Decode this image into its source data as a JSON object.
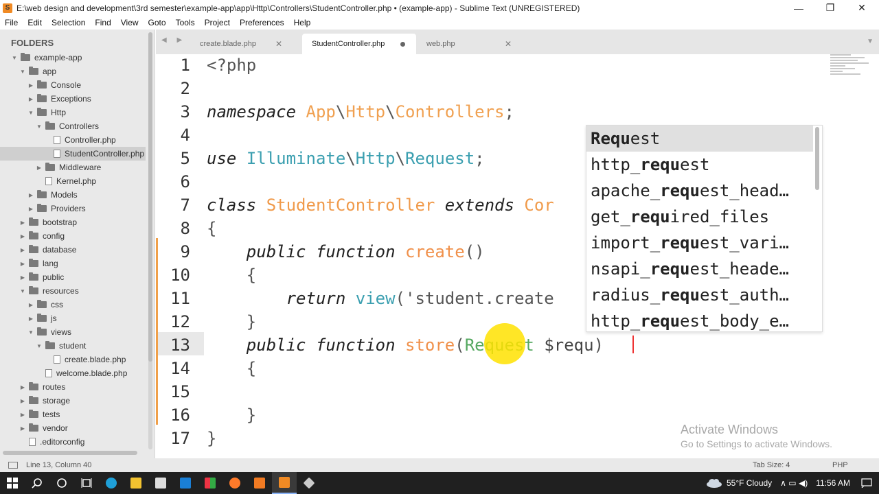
{
  "window": {
    "title": "E:\\web design and development\\3rd semester\\example-app\\app\\Http\\Controllers\\StudentController.php • (example-app) - Sublime Text (UNREGISTERED)",
    "minimize": "—",
    "maximize": "❐",
    "close": "✕"
  },
  "menu": [
    "File",
    "Edit",
    "Selection",
    "Find",
    "View",
    "Goto",
    "Tools",
    "Project",
    "Preferences",
    "Help"
  ],
  "sidebar": {
    "header": "FOLDERS",
    "items": [
      {
        "label": "example-app",
        "type": "folder",
        "depth": 0,
        "open": true
      },
      {
        "label": "app",
        "type": "folder",
        "depth": 1,
        "open": true
      },
      {
        "label": "Console",
        "type": "folder",
        "depth": 2,
        "open": false
      },
      {
        "label": "Exceptions",
        "type": "folder",
        "depth": 2,
        "open": false
      },
      {
        "label": "Http",
        "type": "folder",
        "depth": 2,
        "open": true
      },
      {
        "label": "Controllers",
        "type": "folder",
        "depth": 3,
        "open": true
      },
      {
        "label": "Controller.php",
        "type": "file",
        "depth": 4
      },
      {
        "label": "StudentController.php",
        "type": "file",
        "depth": 4,
        "selected": true
      },
      {
        "label": "Middleware",
        "type": "folder",
        "depth": 3,
        "open": false
      },
      {
        "label": "Kernel.php",
        "type": "file",
        "depth": 3
      },
      {
        "label": "Models",
        "type": "folder",
        "depth": 2,
        "open": false
      },
      {
        "label": "Providers",
        "type": "folder",
        "depth": 2,
        "open": false
      },
      {
        "label": "bootstrap",
        "type": "folder",
        "depth": 1,
        "open": false
      },
      {
        "label": "config",
        "type": "folder",
        "depth": 1,
        "open": false
      },
      {
        "label": "database",
        "type": "folder",
        "depth": 1,
        "open": false
      },
      {
        "label": "lang",
        "type": "folder",
        "depth": 1,
        "open": false
      },
      {
        "label": "public",
        "type": "folder",
        "depth": 1,
        "open": false
      },
      {
        "label": "resources",
        "type": "folder",
        "depth": 1,
        "open": true
      },
      {
        "label": "css",
        "type": "folder",
        "depth": 2,
        "open": false
      },
      {
        "label": "js",
        "type": "folder",
        "depth": 2,
        "open": false
      },
      {
        "label": "views",
        "type": "folder",
        "depth": 2,
        "open": true
      },
      {
        "label": "student",
        "type": "folder",
        "depth": 3,
        "open": true
      },
      {
        "label": "create.blade.php",
        "type": "file",
        "depth": 4
      },
      {
        "label": "welcome.blade.php",
        "type": "file",
        "depth": 3
      },
      {
        "label": "routes",
        "type": "folder",
        "depth": 1,
        "open": false
      },
      {
        "label": "storage",
        "type": "folder",
        "depth": 1,
        "open": false
      },
      {
        "label": "tests",
        "type": "folder",
        "depth": 1,
        "open": false
      },
      {
        "label": "vendor",
        "type": "folder",
        "depth": 1,
        "open": false
      },
      {
        "label": ".editorconfig",
        "type": "file",
        "depth": 1
      }
    ]
  },
  "tabs": {
    "nav": "◀ ▶",
    "menu": "▼",
    "items": [
      {
        "label": "create.blade.php",
        "close": "✕",
        "active": false
      },
      {
        "label": "StudentController.php",
        "close": "●",
        "active": true
      },
      {
        "label": "web.php",
        "close": "✕",
        "active": false
      }
    ]
  },
  "editor": {
    "line_numbers": [
      "1",
      "2",
      "3",
      "4",
      "5",
      "6",
      "7",
      "8",
      "9",
      "10",
      "11",
      "12",
      "13",
      "14",
      "15",
      "16",
      "17"
    ],
    "lines": [
      [
        [
          "<?php",
          "pn"
        ]
      ],
      [],
      [
        [
          "namespace",
          "kw"
        ],
        [
          " ",
          ""
        ],
        [
          "App",
          "ns"
        ],
        [
          "\\",
          "pn"
        ],
        [
          "Http",
          "ns"
        ],
        [
          "\\",
          "pn"
        ],
        [
          "Controllers",
          "ns"
        ],
        [
          ";",
          "pn"
        ]
      ],
      [],
      [
        [
          "use",
          "kw"
        ],
        [
          " ",
          ""
        ],
        [
          "Illuminate",
          "ty"
        ],
        [
          "\\",
          "pn"
        ],
        [
          "Http",
          "ty"
        ],
        [
          "\\",
          "pn"
        ],
        [
          "Request",
          "ty"
        ],
        [
          ";",
          "pn"
        ]
      ],
      [],
      [
        [
          "class",
          "kw"
        ],
        [
          " ",
          ""
        ],
        [
          "StudentController",
          "cls"
        ],
        [
          " ",
          ""
        ],
        [
          "extends",
          "kw"
        ],
        [
          " ",
          ""
        ],
        [
          "Cor",
          "cls"
        ]
      ],
      [
        [
          "{",
          "pn"
        ]
      ],
      [
        [
          "    ",
          ""
        ],
        [
          "public",
          "kw"
        ],
        [
          " ",
          ""
        ],
        [
          "function",
          "kw"
        ],
        [
          " ",
          ""
        ],
        [
          "create",
          "fn"
        ],
        [
          "()",
          "pn"
        ]
      ],
      [
        [
          "    ",
          ""
        ],
        [
          "{",
          "pn"
        ]
      ],
      [
        [
          "        ",
          ""
        ],
        [
          "return",
          "kw"
        ],
        [
          " ",
          ""
        ],
        [
          "view",
          "ty"
        ],
        [
          "(",
          "pn"
        ],
        [
          "'student.create",
          "pn"
        ]
      ],
      [
        [
          "    ",
          ""
        ],
        [
          "}",
          "pn"
        ]
      ],
      [
        [
          "    ",
          ""
        ],
        [
          "public",
          "kw"
        ],
        [
          " ",
          ""
        ],
        [
          "function",
          "kw"
        ],
        [
          " ",
          ""
        ],
        [
          "store",
          "fn"
        ],
        [
          "(",
          "pn"
        ],
        [
          "Request",
          "str"
        ],
        [
          " ",
          ""
        ],
        [
          "$requ",
          "var"
        ],
        [
          ")",
          "pn"
        ]
      ],
      [
        [
          "    ",
          ""
        ],
        [
          "{",
          "pn"
        ]
      ],
      [],
      [
        [
          "    ",
          ""
        ],
        [
          "}",
          "pn"
        ]
      ],
      [
        [
          "}",
          "pn"
        ]
      ]
    ]
  },
  "autocomplete": {
    "items": [
      {
        "pre": "",
        "match": "Requ",
        "post": "est",
        "selected": true
      },
      {
        "pre": "http_",
        "match": "requ",
        "post": "est"
      },
      {
        "pre": "apache_",
        "match": "requ",
        "post": "est_head…"
      },
      {
        "pre": "get_",
        "match": "requ",
        "post": "ired_files"
      },
      {
        "pre": "import_",
        "match": "requ",
        "post": "est_vari…"
      },
      {
        "pre": "nsapi_",
        "match": "requ",
        "post": "est_heade…"
      },
      {
        "pre": "radius_",
        "match": "requ",
        "post": "est_auth…"
      },
      {
        "pre": "http_",
        "match": "requ",
        "post": "est_body_e…"
      }
    ]
  },
  "watermark": {
    "line1": "Activate Windows",
    "line2": "Go to Settings to activate Windows."
  },
  "status": {
    "position": "Line 13, Column 40",
    "tab_size": "Tab Size: 4",
    "syntax": "PHP"
  },
  "taskbar": {
    "weather": "55°F  Cloudy",
    "time": "11:56 AM",
    "tray_icons": "∧  ▭  ◀)"
  },
  "colors": {
    "accent": "#f0a04a",
    "taskbar": "#202020"
  }
}
